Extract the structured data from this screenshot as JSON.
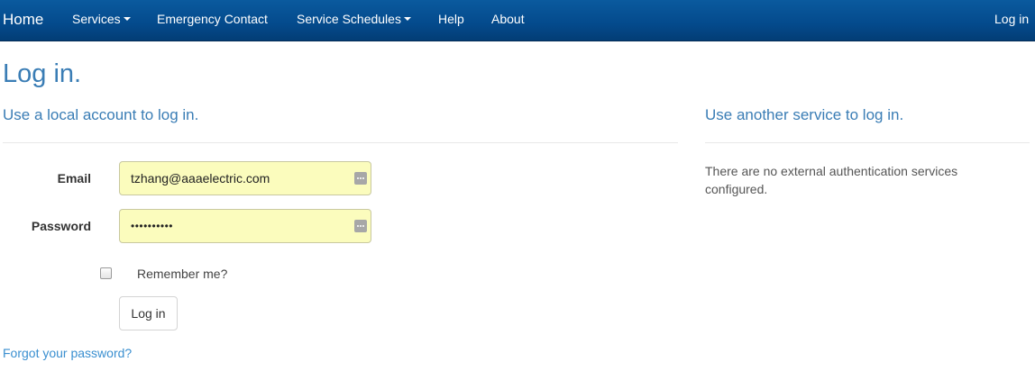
{
  "navbar": {
    "brand": "Home",
    "items": [
      {
        "label": "Services",
        "dropdown": true
      },
      {
        "label": "Emergency Contact",
        "dropdown": false
      },
      {
        "label": "Service Schedules",
        "dropdown": true
      },
      {
        "label": "Help",
        "dropdown": false
      },
      {
        "label": "About",
        "dropdown": false
      }
    ],
    "login_link": "Log in"
  },
  "page": {
    "title": "Log in."
  },
  "local_account": {
    "heading": "Use a local account to log in.",
    "email_label": "Email",
    "email_value": "tzhang@aaaelectric.com",
    "password_label": "Password",
    "password_mask": "••••••••••",
    "remember_label": "Remember me?",
    "remember_checked": false,
    "submit_label": "Log in",
    "forgot_link": "Forgot your password?"
  },
  "external": {
    "heading": "Use another service to log in.",
    "message": "There are no external authentication services configured."
  },
  "colors": {
    "navbar": "#044a8c",
    "heading": "#3a7db5",
    "link": "#3a8fd0",
    "autofill_bg": "#fbfcbd"
  }
}
